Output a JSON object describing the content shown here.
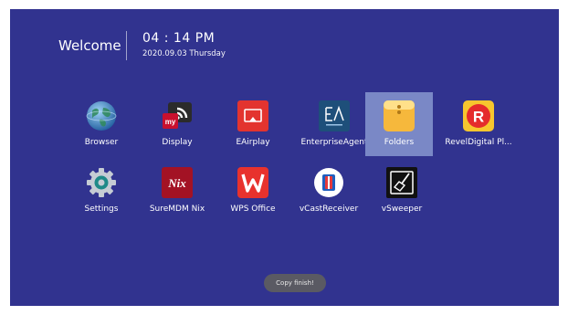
{
  "header": {
    "welcome": "Welcome",
    "time": "04 : 14 PM",
    "date": "2020.09.03 Thursday"
  },
  "apps": [
    {
      "label": "Browser",
      "icon": "globe-icon"
    },
    {
      "label": "Display",
      "icon": "cast-icon"
    },
    {
      "label": "EAirplay",
      "icon": "airplay-icon"
    },
    {
      "label": "EnterpriseAgent",
      "icon": "enterprise-agent-icon"
    },
    {
      "label": "Folders",
      "icon": "folder-icon",
      "selected": true
    },
    {
      "label": "RevelDigital Pl...",
      "icon": "revel-digital-icon"
    },
    {
      "label": "Settings",
      "icon": "gear-icon"
    },
    {
      "label": "SureMDM Nix",
      "icon": "nix-icon"
    },
    {
      "label": "WPS Office",
      "icon": "wps-icon"
    },
    {
      "label": "vCastReceiver",
      "icon": "vcast-icon"
    },
    {
      "label": "vSweeper",
      "icon": "broom-icon"
    }
  ],
  "toast": "Copy finish!",
  "colors": {
    "background": "#31338f",
    "selected": "#7a88c6",
    "toast": "#5a5a63"
  }
}
